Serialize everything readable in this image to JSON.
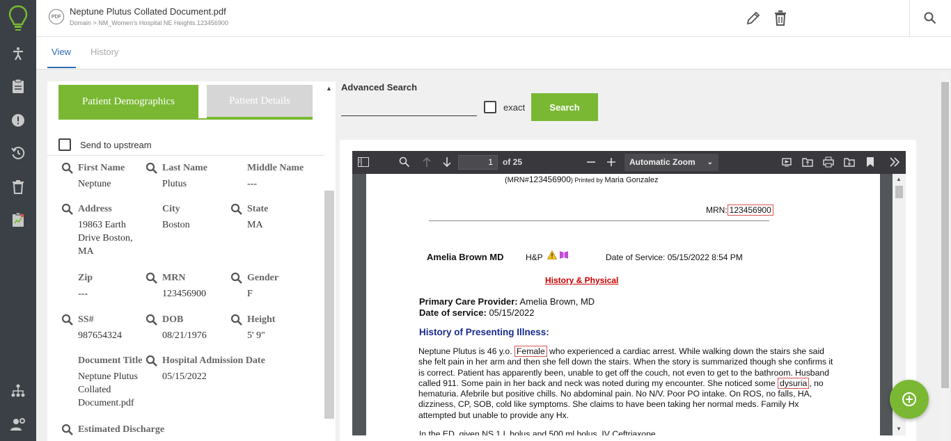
{
  "document": {
    "badge": "PDF",
    "title": "Neptune Plutus Collated Document.pdf",
    "path": "Domain > NM_Women's Hospital NE Heights.123456900"
  },
  "tabs": {
    "view": "View",
    "history": "History"
  },
  "segments": {
    "patient_demographics": "Patient Demographics",
    "patient_details": "Patient Details"
  },
  "send_upstream": "Send to upstream",
  "fields": {
    "first_name": {
      "label": "First Name",
      "value": "Neptune"
    },
    "last_name": {
      "label": "Last Name",
      "value": "Plutus"
    },
    "middle_name": {
      "label": "Middle Name",
      "value": "---"
    },
    "address": {
      "label": "Address",
      "value": "19863 Earth Drive Boston, MA"
    },
    "city": {
      "label": "City",
      "value": "Boston"
    },
    "state": {
      "label": "State",
      "value": "MA"
    },
    "zip": {
      "label": "Zip",
      "value": "---"
    },
    "mrn": {
      "label": "MRN",
      "value": "123456900"
    },
    "gender": {
      "label": "Gender",
      "value": "F"
    },
    "ssn": {
      "label": "SS#",
      "value": "987654324"
    },
    "dob": {
      "label": "DOB",
      "value": "08/21/1976"
    },
    "height": {
      "label": "Height",
      "value": "5' 9\""
    },
    "document_title": {
      "label": "Document Title",
      "value": "Neptune Plutus Collated Document.pdf"
    },
    "admission_date": {
      "label": "Hospital Admission Date",
      "value": "05/15/2022"
    },
    "estimated_discharge": {
      "label": "Estimated Discharge",
      "value": ""
    }
  },
  "advanced_search": {
    "label": "Advanced Search",
    "value": "",
    "exact_label": "exact",
    "search_button": "Search"
  },
  "pdf_viewer": {
    "page": "1",
    "of_pages": "of 25",
    "zoom": "Automatic Zoom",
    "page_content": {
      "printed_by_prefix": "(MRN#",
      "printed_by_mrn": "123456900",
      "printed_by_suffix": ") Printed by ",
      "printed_by_name": "Maria Gonzalez",
      "mrn_label": "MRN:",
      "mrn_value": "123456900",
      "provider": "Amelia Brown MD",
      "note_type": "H&P",
      "date_of_service_header": "Date of Service: 05/15/2022 8:54 PM",
      "section_title": "History & Physical",
      "pcp_label": "Primary Care Provider:",
      "pcp_value": "Amelia Brown, MD",
      "dos_label": "Date of service:",
      "dos_value": "05/15/2022",
      "hpi_heading": "History of Presenting Illness:",
      "hpi_pre": "Neptune Plutus is 46 y.o.",
      "hpi_highlight1": "Female",
      "hpi_mid": "who experienced a cardiac arrest. While walking down the stairs she said she felt pain in her arm and then she fell down the stairs. When the story is summarized though she confirms it is correct. Patient has apparently been, unable to get off the couch, not even to get to the bathroom. Husband called 911. Some pain in her back and neck was noted during my encounter. She noticed some",
      "hpi_highlight2": "dysuria",
      "hpi_post": ", no hematuria. Afebrile but positive chills. No abdominal pain. No N/V. Poor PO intake. On ROS, no falls, HA, dizziness, CP, SOB, cold like symptoms. She claims to have been taking her normal meds. Family Hx attempted but unable to provide any Hx.",
      "ed_line": "In the ED, given NS 1 L bolus and 500 ml bolus, IV Ceftriaxone"
    }
  },
  "colors": {
    "accent_green": "#7ab833",
    "link_blue": "#2b6cb0",
    "rail": "#3a4045",
    "highlight_red": "#d9534f"
  },
  "icons": {
    "rail": [
      "lightbulb-logo-icon",
      "accessibility-icon",
      "clipboard-icon",
      "alert-icon",
      "history-icon",
      "trash-icon",
      "report-icon",
      "hierarchy-icon",
      "user-settings-icon"
    ],
    "topbar": [
      "pdf-icon",
      "edit-icon",
      "delete-icon",
      "search-icon"
    ]
  }
}
